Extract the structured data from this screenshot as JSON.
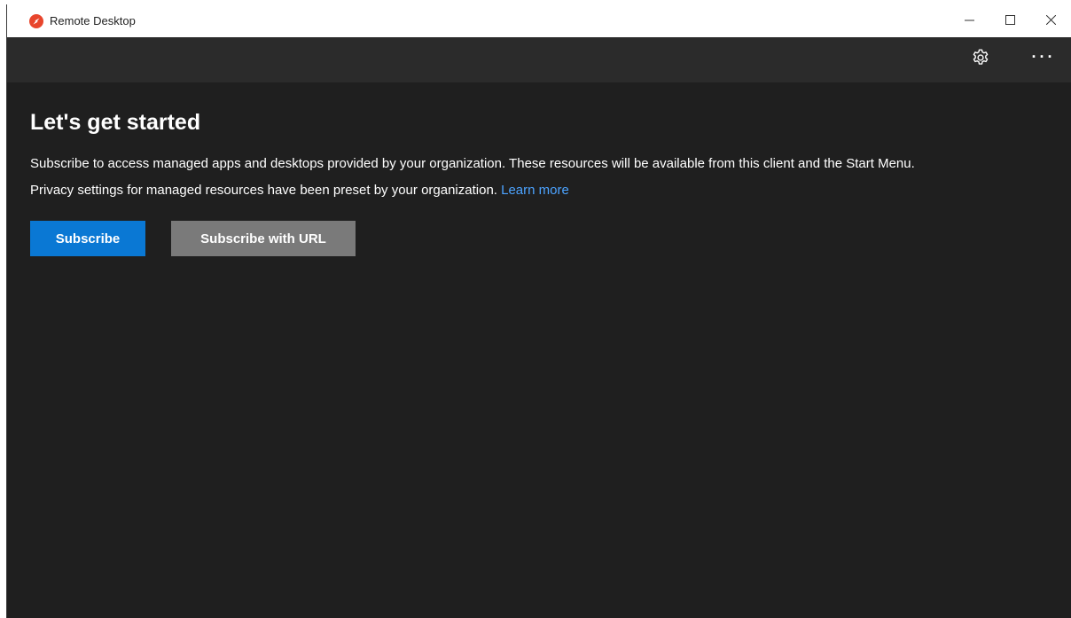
{
  "window": {
    "title": "Remote Desktop",
    "app_icon": "remote-desktop-icon",
    "controls": [
      "minimize-icon",
      "maximize-icon",
      "close-icon"
    ]
  },
  "toolbar": {
    "settings_icon": "gear-icon",
    "more_icon": "more-options-icon",
    "more_label": "···"
  },
  "main": {
    "title": "Let's get started",
    "description": "Subscribe to access managed apps and desktops provided by your organization. These resources will be available from this client and the Start Menu.",
    "privacy_text": "Privacy settings for managed resources have been preset by your organization. ",
    "learn_more": "Learn more",
    "subscribe_label": "Subscribe",
    "subscribe_url_label": "Subscribe with URL"
  },
  "colors": {
    "accent": "#0a78d4",
    "secondary_button": "#7a7a7a",
    "link": "#4ca3ff",
    "background": "#1f1f1f",
    "toolbar": "#2b2b2b",
    "app_icon": "#e8452c"
  }
}
